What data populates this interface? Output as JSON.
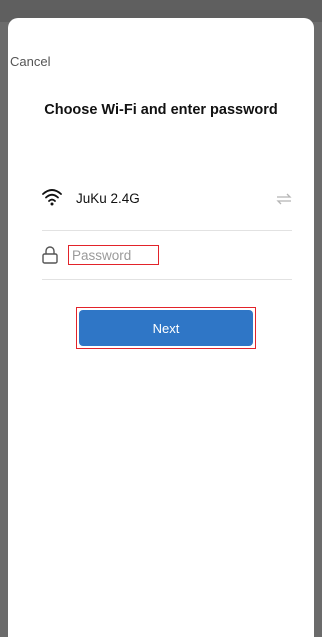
{
  "header": {
    "cancel_label": "Cancel",
    "title": "Choose Wi-Fi and enter password"
  },
  "wifi": {
    "ssid": "JuKu 2.4G",
    "icon": "wifi-icon",
    "switch_icon": "switch-network-icon"
  },
  "password": {
    "placeholder": "Password",
    "value": "",
    "icon": "lock-icon"
  },
  "actions": {
    "next_label": "Next",
    "next_color": "#2f76c6"
  },
  "highlight_color": "#e2232a"
}
